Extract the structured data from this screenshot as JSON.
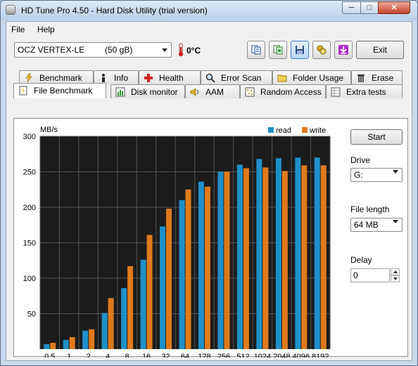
{
  "window": {
    "title": "HD Tune Pro 4.50 - Hard Disk Utility (trial version)",
    "minimize": "─",
    "maximize": "□",
    "close": "✕"
  },
  "menu": {
    "file": "File",
    "help": "Help"
  },
  "toolbar": {
    "drive_name": "OCZ VERTEX-LE",
    "drive_size": "(50 gB)",
    "temperature": "0°C",
    "exit_label": "Exit",
    "buttons": [
      "copy-text-icon",
      "copy-screenshot-icon",
      "save-icon",
      "options-icon",
      "exit-down-icon"
    ]
  },
  "tabs_top": [
    {
      "label": "Benchmark",
      "icon": "benchmark-icon"
    },
    {
      "label": "Info",
      "icon": "info-icon"
    },
    {
      "label": "Health",
      "icon": "health-icon"
    },
    {
      "label": "Error Scan",
      "icon": "error-scan-icon"
    },
    {
      "label": "Folder Usage",
      "icon": "folder-icon"
    },
    {
      "label": "Erase",
      "icon": "trash-icon"
    }
  ],
  "tabs_bottom": [
    {
      "label": "File Benchmark",
      "icon": "file-benchmark-icon",
      "active": true
    },
    {
      "label": "Disk monitor",
      "icon": "disk-monitor-icon"
    },
    {
      "label": "AAM",
      "icon": "speaker-icon"
    },
    {
      "label": "Random Access",
      "icon": "random-access-icon"
    },
    {
      "label": "Extra tests",
      "icon": "extra-tests-icon"
    }
  ],
  "side": {
    "start_label": "Start",
    "drive_label": "Drive",
    "drive_value": "G:",
    "file_length_label": "File length",
    "file_length_value": "64 MB",
    "delay_label": "Delay",
    "delay_value": "0"
  },
  "colors": {
    "read": "#1e90c8",
    "write": "#e07a1a",
    "plot_bg": "#1c1c1c",
    "grid": "#555555"
  },
  "chart_data": {
    "type": "bar",
    "ylabel": "MB/s",
    "ylim": [
      0,
      300
    ],
    "yticks": [
      50,
      100,
      150,
      200,
      250,
      300
    ],
    "categories": [
      "0.5",
      "1",
      "2",
      "4",
      "8",
      "16",
      "32",
      "64",
      "128",
      "256",
      "512",
      "1024",
      "2048",
      "4096",
      "8192"
    ],
    "series": [
      {
        "name": "read",
        "values": [
          7,
          13,
          26,
          51,
          86,
          126,
          173,
          210,
          236,
          250,
          260,
          268,
          269,
          270,
          270
        ]
      },
      {
        "name": "write",
        "values": [
          9,
          17,
          28,
          72,
          117,
          161,
          198,
          225,
          229,
          250,
          255,
          256,
          251,
          259,
          259
        ]
      }
    ],
    "legend_position": "top-right",
    "grid": true
  }
}
